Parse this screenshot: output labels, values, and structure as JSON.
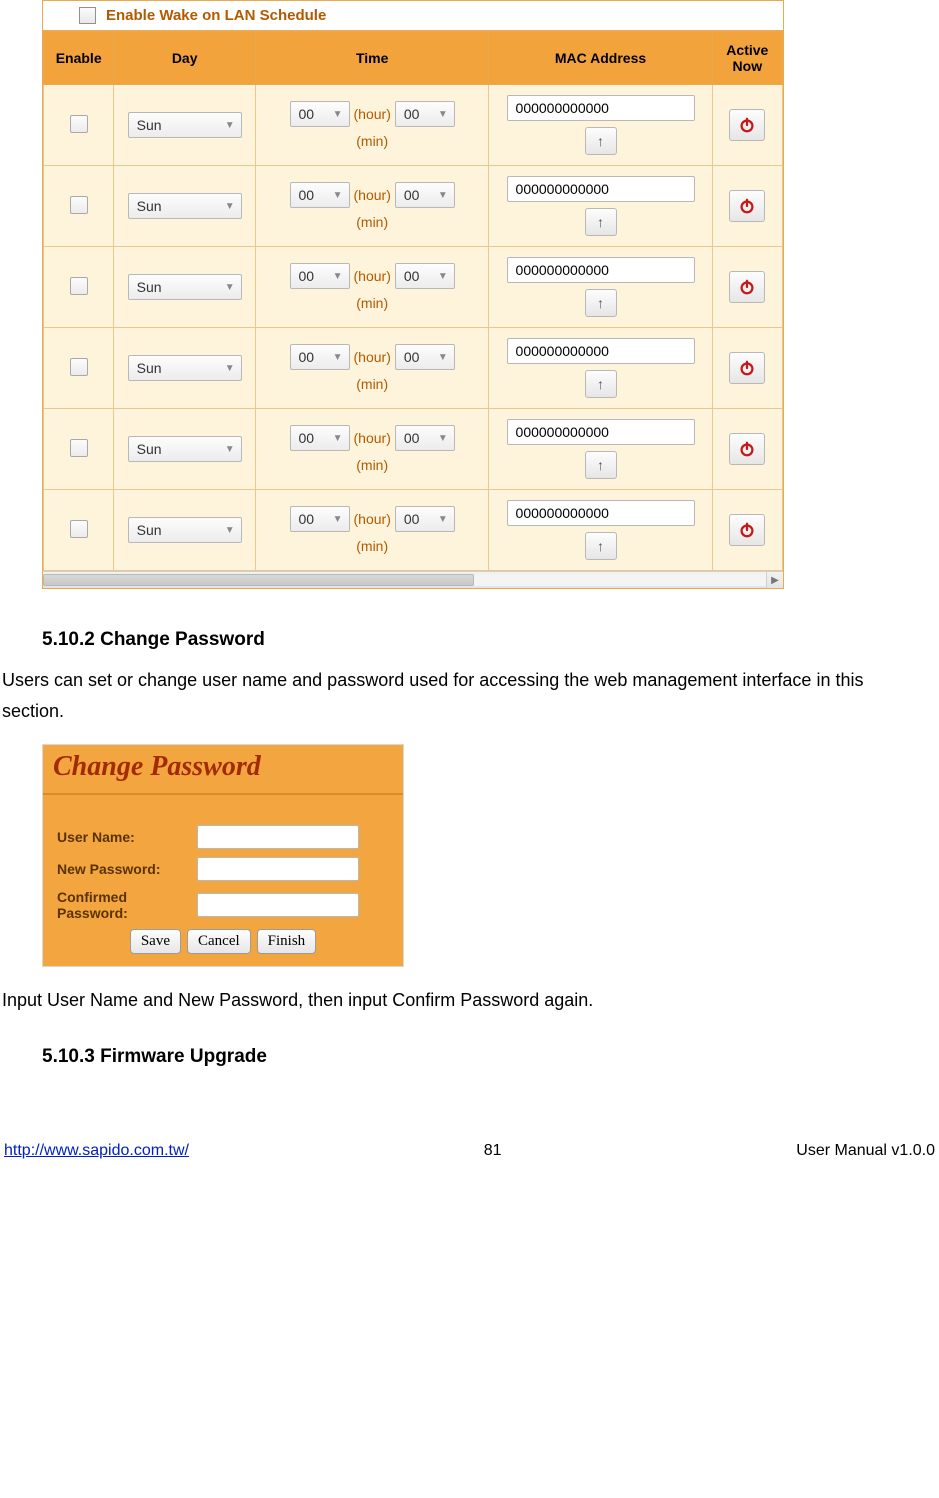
{
  "wol": {
    "enable_label": "Enable Wake on LAN Schedule",
    "headers": {
      "enable": "Enable",
      "day": "Day",
      "time": "Time",
      "mac": "MAC Address",
      "active": "Active Now"
    },
    "time_units": {
      "hour": "(hour)",
      "min": "(min)"
    },
    "rows": [
      {
        "day": "Sun",
        "hour": "00",
        "min": "00",
        "mac": "000000000000"
      },
      {
        "day": "Sun",
        "hour": "00",
        "min": "00",
        "mac": "000000000000"
      },
      {
        "day": "Sun",
        "hour": "00",
        "min": "00",
        "mac": "000000000000"
      },
      {
        "day": "Sun",
        "hour": "00",
        "min": "00",
        "mac": "000000000000"
      },
      {
        "day": "Sun",
        "hour": "00",
        "min": "00",
        "mac": "000000000000"
      },
      {
        "day": "Sun",
        "hour": "00",
        "min": "00",
        "mac": "000000000000"
      }
    ]
  },
  "sections": {
    "s5102": {
      "heading": "5.10.2  Change Password",
      "p1": "Users can set or change user name and password used for accessing the web management interface in this section.",
      "p2": "Input User Name and New Password, then input Confirm Password again."
    },
    "s5103": {
      "heading": "5.10.3  Firmware Upgrade"
    }
  },
  "change_password": {
    "title": "Change Password",
    "labels": {
      "user": "User Name:",
      "newpw": "New Password:",
      "confirm": "Confirmed Password:"
    },
    "buttons": {
      "save": "Save",
      "cancel": "Cancel",
      "finish": "Finish"
    }
  },
  "footer": {
    "url": "http://www.sapido.com.tw/",
    "page": "81",
    "version": "User Manual v1.0.0"
  }
}
